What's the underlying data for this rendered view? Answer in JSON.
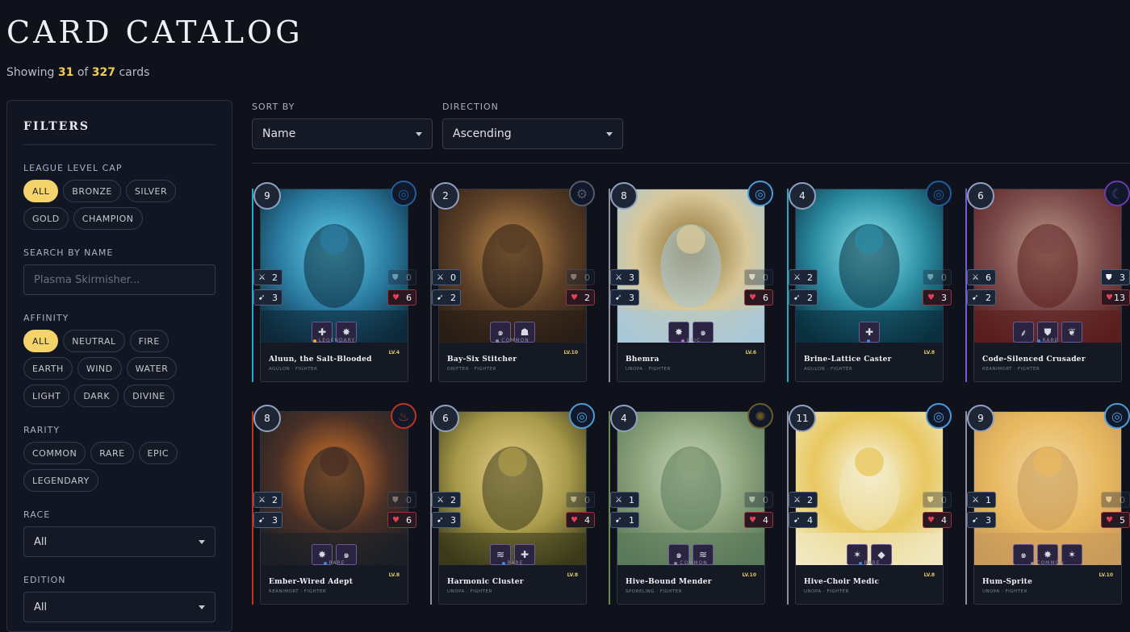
{
  "page": {
    "title": "CARD CATALOG",
    "showing_prefix": "Showing",
    "shown_count": "31",
    "of_word": "of",
    "total_count": "327",
    "cards_word": "cards"
  },
  "filters": {
    "heading": "FILTERS",
    "league": {
      "label": "LEAGUE LEVEL CAP",
      "options": [
        "ALL",
        "BRONZE",
        "SILVER",
        "GOLD",
        "CHAMPION"
      ],
      "selected": "ALL"
    },
    "search": {
      "label": "SEARCH BY NAME",
      "placeholder": "Plasma Skirmisher..."
    },
    "affinity": {
      "label": "AFFINITY",
      "options": [
        "ALL",
        "NEUTRAL",
        "FIRE",
        "EARTH",
        "WIND",
        "WATER",
        "LIGHT",
        "DARK",
        "DIVINE"
      ],
      "selected": "ALL"
    },
    "rarity": {
      "label": "RARITY",
      "options": [
        "COMMON",
        "RARE",
        "EPIC",
        "LEGENDARY"
      ]
    },
    "race": {
      "label": "RACE",
      "value": "All"
    },
    "edition": {
      "label": "EDITION",
      "value": "All"
    }
  },
  "sort": {
    "sort_by_label": "SORT BY",
    "sort_by_value": "Name",
    "direction_label": "DIRECTION",
    "direction_value": "Ascending"
  },
  "colors": {
    "accent": "#f4d46a",
    "water": "#2a8fd8",
    "wind": "#5aa8e0",
    "dark": "#8a5ad0",
    "fire": "#d8402a",
    "earth": "#8a7a3a",
    "neutral": "#666666"
  },
  "cards": [
    {
      "name": "Aluun, the Salt-Blooded",
      "subtitle": "AGULON · FIGHTER",
      "level": "LV.4",
      "cost": "9",
      "rarity": "LEGENDARY",
      "affinity_icon": "water-swirl-icon",
      "attack": "2",
      "speed": "3",
      "armor": "0",
      "health": "6",
      "abilities": [
        "cross-shield-icon",
        "burst-icon"
      ]
    },
    {
      "name": "Bay-Six Stitcher",
      "subtitle": "DRIFTER · FIGHTER",
      "level": "LV.10",
      "cost": "2",
      "rarity": "COMMON",
      "affinity_icon": "gear-icon",
      "attack": "0",
      "speed": "2",
      "armor": "0",
      "health": "2",
      "abilities": [
        "spiral-icon",
        "shield-ghost-icon"
      ]
    },
    {
      "name": "Bhemra",
      "subtitle": "UNOPA · FIGHTER",
      "level": "LV.6",
      "cost": "8",
      "rarity": "EPIC",
      "affinity_icon": "wind-swirl-icon",
      "attack": "3",
      "speed": "3",
      "armor": "0",
      "health": "6",
      "abilities": [
        "burst-icon",
        "spiral-icon"
      ]
    },
    {
      "name": "Brine-Lattice Caster",
      "subtitle": "AGULON · FIGHTER",
      "level": "LV.8",
      "cost": "4",
      "rarity": "",
      "affinity_icon": "water-swirl-icon",
      "attack": "2",
      "speed": "2",
      "armor": "0",
      "health": "3",
      "abilities": [
        "cross-shield-icon"
      ]
    },
    {
      "name": "Code-Silenced Crusader",
      "subtitle": "REANIMORT · FIGHTER",
      "level": "",
      "cost": "6",
      "rarity": "RARE",
      "affinity_icon": "moon-icon",
      "attack": "6",
      "speed": "2",
      "armor": "3",
      "health": "13",
      "abilities": [
        "claw-icon",
        "shield-icon",
        "wings-icon"
      ]
    },
    {
      "name": "Ember-Wired Adept",
      "subtitle": "REANIMORT · FIGHTER",
      "level": "LV.8",
      "cost": "8",
      "rarity": "RARE",
      "affinity_icon": "flame-icon",
      "attack": "2",
      "speed": "3",
      "armor": "0",
      "health": "6",
      "abilities": [
        "burst-icon",
        "spiral-icon"
      ]
    },
    {
      "name": "Harmonic Cluster",
      "subtitle": "UNOPA · FIGHTER",
      "level": "LV.8",
      "cost": "6",
      "rarity": "RARE",
      "affinity_icon": "wind-swirl-icon",
      "attack": "2",
      "speed": "3",
      "armor": "0",
      "health": "4",
      "abilities": [
        "swirl-icon",
        "cross-shield-icon"
      ]
    },
    {
      "name": "Hive-Bound Mender",
      "subtitle": "SPORELING · FIGHTER",
      "level": "LV.10",
      "cost": "4",
      "rarity": "COMMON",
      "affinity_icon": "earth-icon",
      "attack": "1",
      "speed": "1",
      "armor": "0",
      "health": "4",
      "abilities": [
        "spiral-icon",
        "swirl-icon"
      ]
    },
    {
      "name": "Hive-Choir Medic",
      "subtitle": "UNOPA · FIGHTER",
      "level": "LV.8",
      "cost": "11",
      "rarity": "RARE",
      "affinity_icon": "wind-swirl-icon",
      "attack": "2",
      "speed": "4",
      "armor": "0",
      "health": "4",
      "abilities": [
        "star-icon",
        "crystal-icon"
      ]
    },
    {
      "name": "Hum-Sprite",
      "subtitle": "UNOPA · FIGHTER",
      "level": "LV.10",
      "cost": "9",
      "rarity": "COMMON",
      "affinity_icon": "wind-swirl-icon",
      "attack": "1",
      "speed": "3",
      "armor": "0",
      "health": "5",
      "abilities": [
        "spiral-icon",
        "burst-icon",
        "star-icon"
      ]
    }
  ]
}
